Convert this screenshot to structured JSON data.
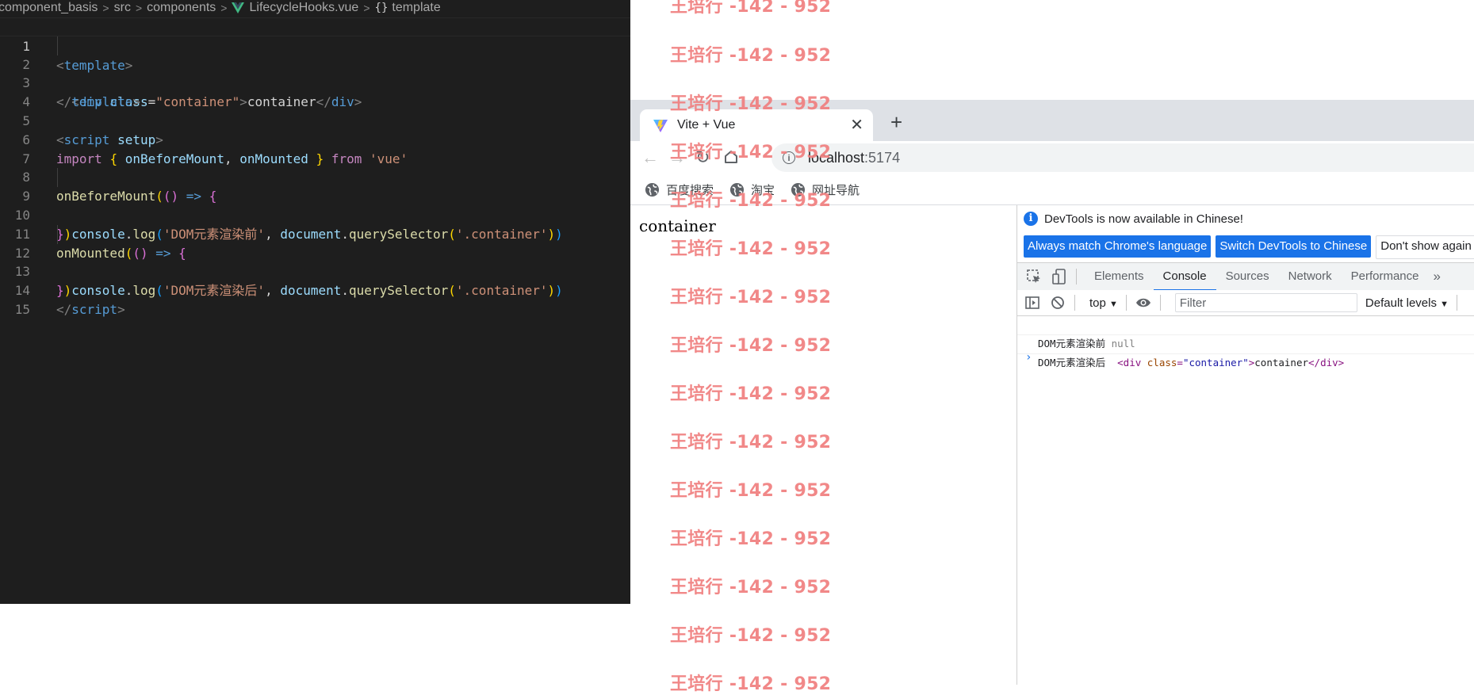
{
  "editor": {
    "breadcrumb": [
      "component_basis",
      "src",
      "components",
      "LifecycleHooks.vue",
      "template"
    ],
    "line_numbers": [
      "1",
      "2",
      "3",
      "4",
      "5",
      "6",
      "7",
      "8",
      "9",
      "10",
      "11",
      "12",
      "13",
      "14",
      "15"
    ],
    "code": {
      "l1_tag": "template",
      "l2_tag": "div",
      "l2_attr": "class",
      "l2_val": "\"container\"",
      "l2_text": "container",
      "l3_tag": "template",
      "l5_tag": "script",
      "l5_attr": "setup",
      "l6_import": "import",
      "l6_name1": "onBeforeMount",
      "l6_name2": "onMounted",
      "l6_from": "from",
      "l6_module": "'vue'",
      "l8_fn": "onBeforeMount",
      "l9_obj": "console",
      "l9_method": "log",
      "l9_str": "'DOM元素渲染前'",
      "l9_doc": "document",
      "l9_qs": "querySelector",
      "l9_sel": "'.container'",
      "l11_fn": "onMounted",
      "l12_obj": "console",
      "l12_method": "log",
      "l12_str": "'DOM元素渲染后'",
      "l12_doc": "document",
      "l12_qs": "querySelector",
      "l12_sel": "'.container'",
      "l14_tag": "script"
    }
  },
  "browser": {
    "tab_title": "Vite + Vue",
    "url_host": "localhost",
    "url_port": ":5174",
    "bookmarks": [
      "百度搜索",
      "淘宝",
      "网址导航"
    ],
    "page_text": "container"
  },
  "devtools": {
    "info_message": "DevTools is now available in Chinese!",
    "buttons": [
      "Always match Chrome's language",
      "Switch DevTools to Chinese",
      "Don't show again"
    ],
    "tabs": [
      "Elements",
      "Console",
      "Sources",
      "Network",
      "Performance"
    ],
    "active_tab": "Console",
    "context": "top",
    "filter_placeholder": "Filter",
    "levels": "Default levels",
    "console": {
      "row1_label": "DOM元素渲染前",
      "row1_value": "null",
      "row2_label": "DOM元素渲染后",
      "row2_tag": "div",
      "row2_attr": "class",
      "row2_val": "\"container\"",
      "row2_text": "container"
    }
  },
  "watermark": "王培行 -142 - 952",
  "colors": {
    "editor_bg": "#1e1e1e",
    "accent": "#1a73e8",
    "watermark": "#f08080"
  }
}
